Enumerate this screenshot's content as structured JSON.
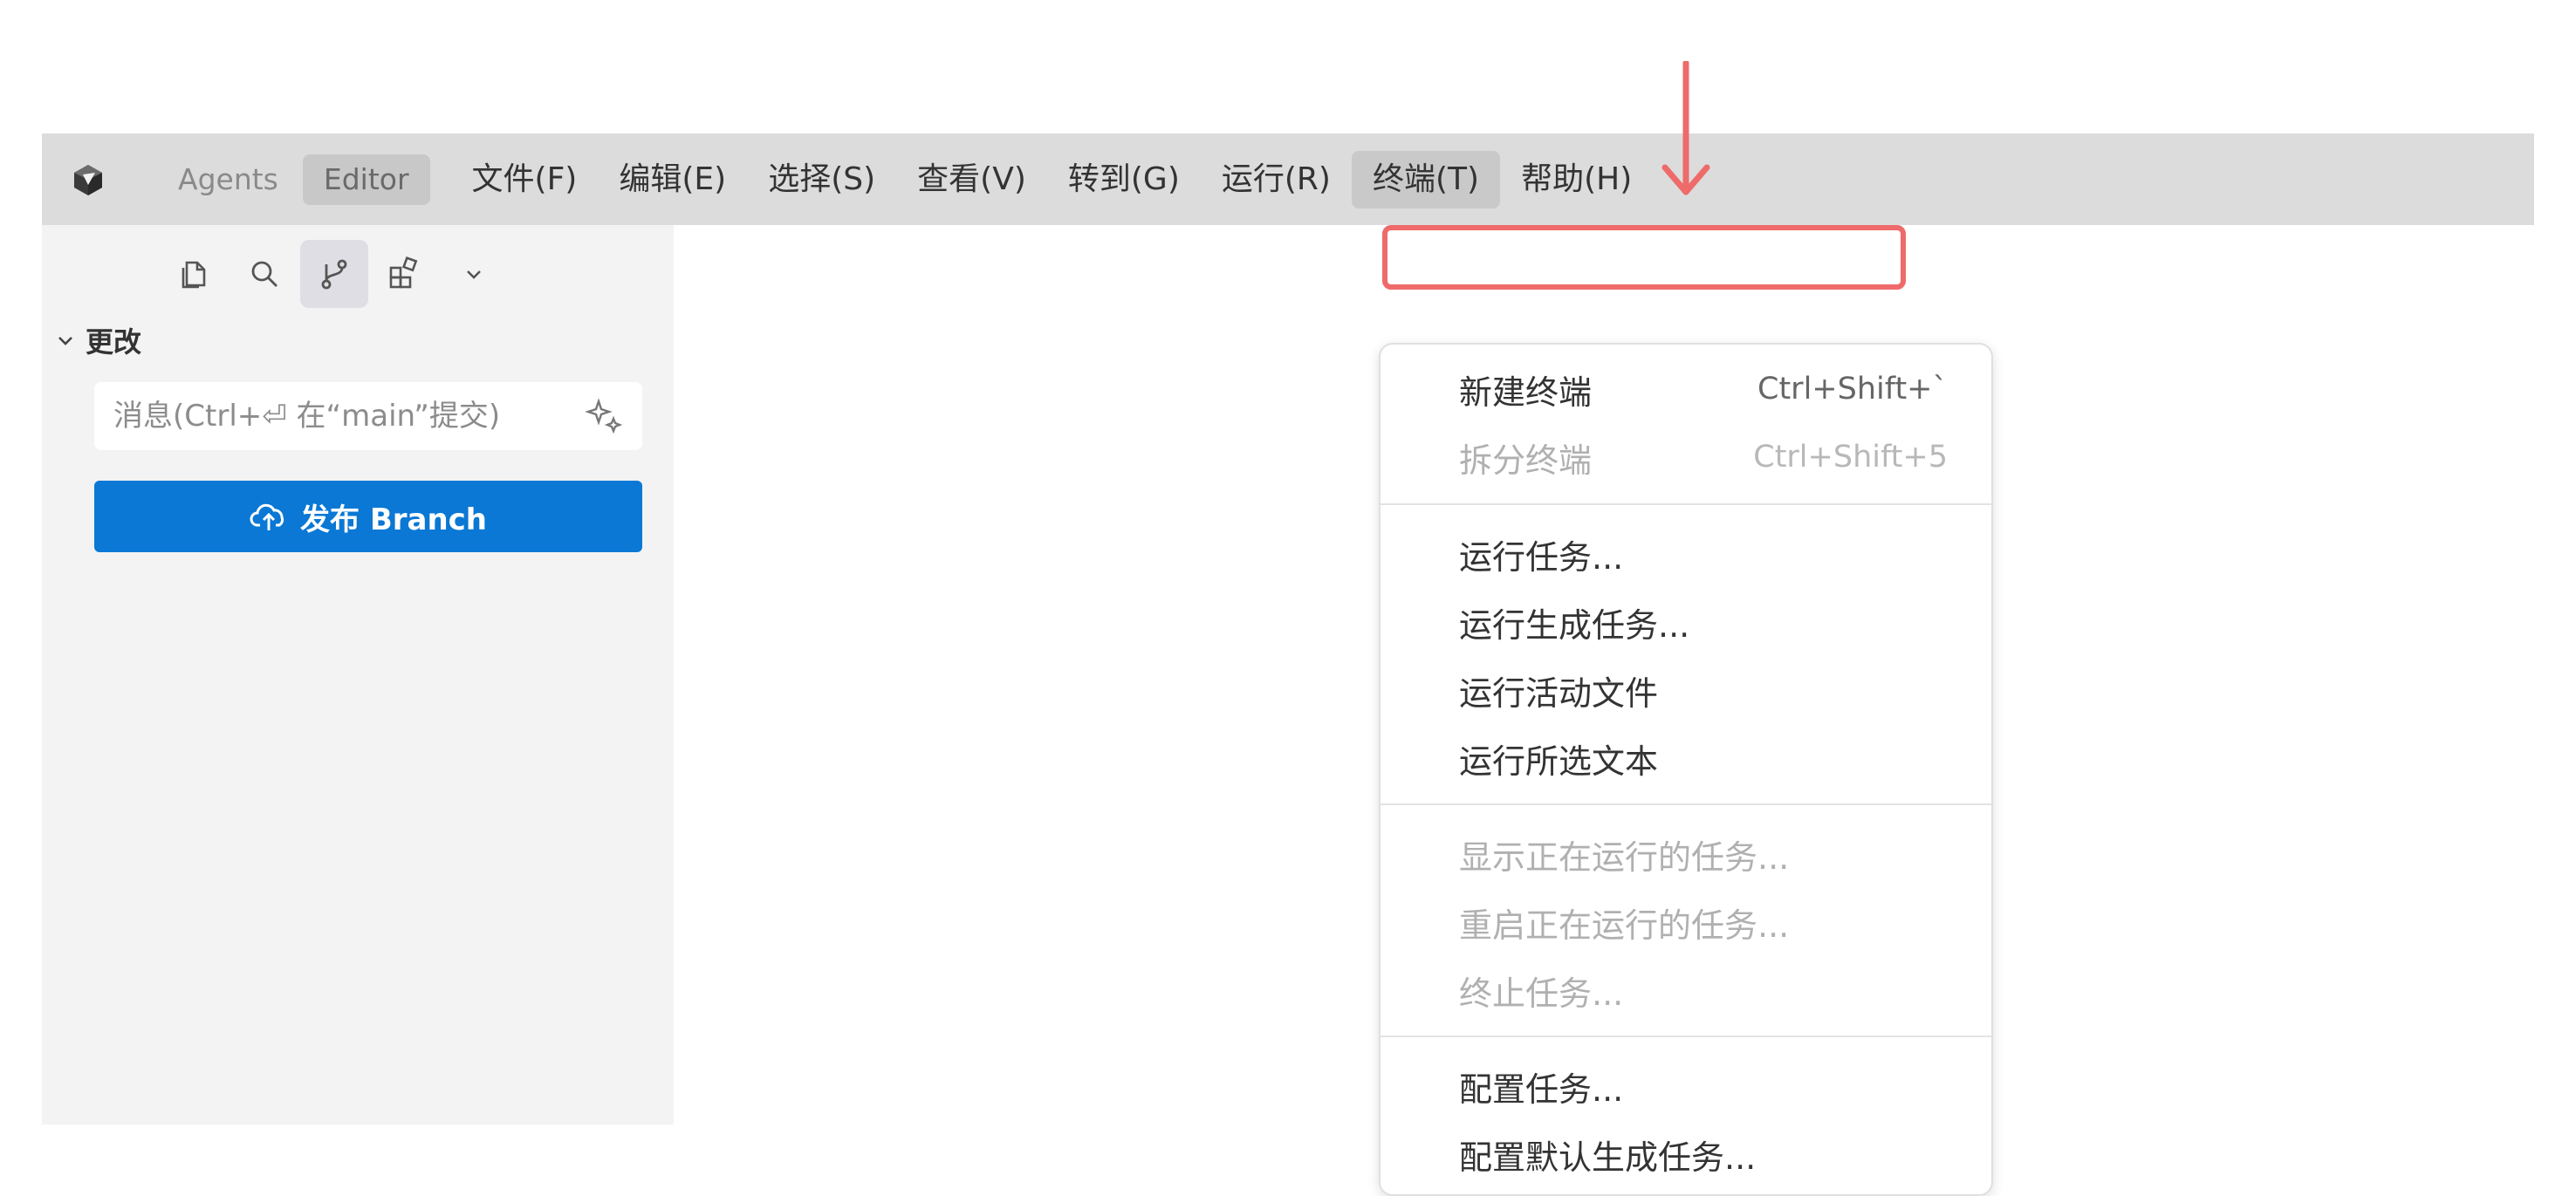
{
  "menubar": {
    "logo_icon": "cursor-cube-icon",
    "modes": [
      {
        "label": "Agents",
        "active": false
      },
      {
        "label": "Editor",
        "active": true
      }
    ],
    "menus": [
      {
        "label": "文件(F)"
      },
      {
        "label": "编辑(E)"
      },
      {
        "label": "选择(S)"
      },
      {
        "label": "查看(V)"
      },
      {
        "label": "转到(G)"
      },
      {
        "label": "运行(R)"
      },
      {
        "label": "终端(T)",
        "open": true
      },
      {
        "label": "帮助(H)"
      }
    ]
  },
  "sidebar": {
    "activity_icons": [
      "explorer-icon",
      "search-icon",
      "source-control-icon",
      "extensions-icon",
      "chevron-down-icon"
    ],
    "active_activity": "source-control-icon",
    "section_title": "更改",
    "commit_placeholder": "消息(Ctrl+⏎ 在“main”提交)",
    "publish_label": "发布 Branch"
  },
  "terminal_menu": {
    "groups": [
      [
        {
          "label": "新建终端",
          "shortcut": "Ctrl+Shift+`",
          "disabled": false,
          "highlighted": true
        },
        {
          "label": "拆分终端",
          "shortcut": "Ctrl+Shift+5",
          "disabled": true
        }
      ],
      [
        {
          "label": "运行任务...",
          "disabled": false
        },
        {
          "label": "运行生成任务...",
          "disabled": false
        },
        {
          "label": "运行活动文件",
          "disabled": false
        },
        {
          "label": "运行所选文本",
          "disabled": false
        }
      ],
      [
        {
          "label": "显示正在运行的任务...",
          "disabled": true
        },
        {
          "label": "重启正在运行的任务...",
          "disabled": true
        },
        {
          "label": "终止任务...",
          "disabled": true
        }
      ],
      [
        {
          "label": "配置任务...",
          "disabled": false
        },
        {
          "label": "配置默认生成任务...",
          "disabled": false
        }
      ]
    ]
  },
  "colors": {
    "menubar_bg": "#dcdcdc",
    "sidebar_bg": "#f3f3f3",
    "accent_button": "#0a78d4",
    "annotation_red": "#ef6a6a"
  }
}
